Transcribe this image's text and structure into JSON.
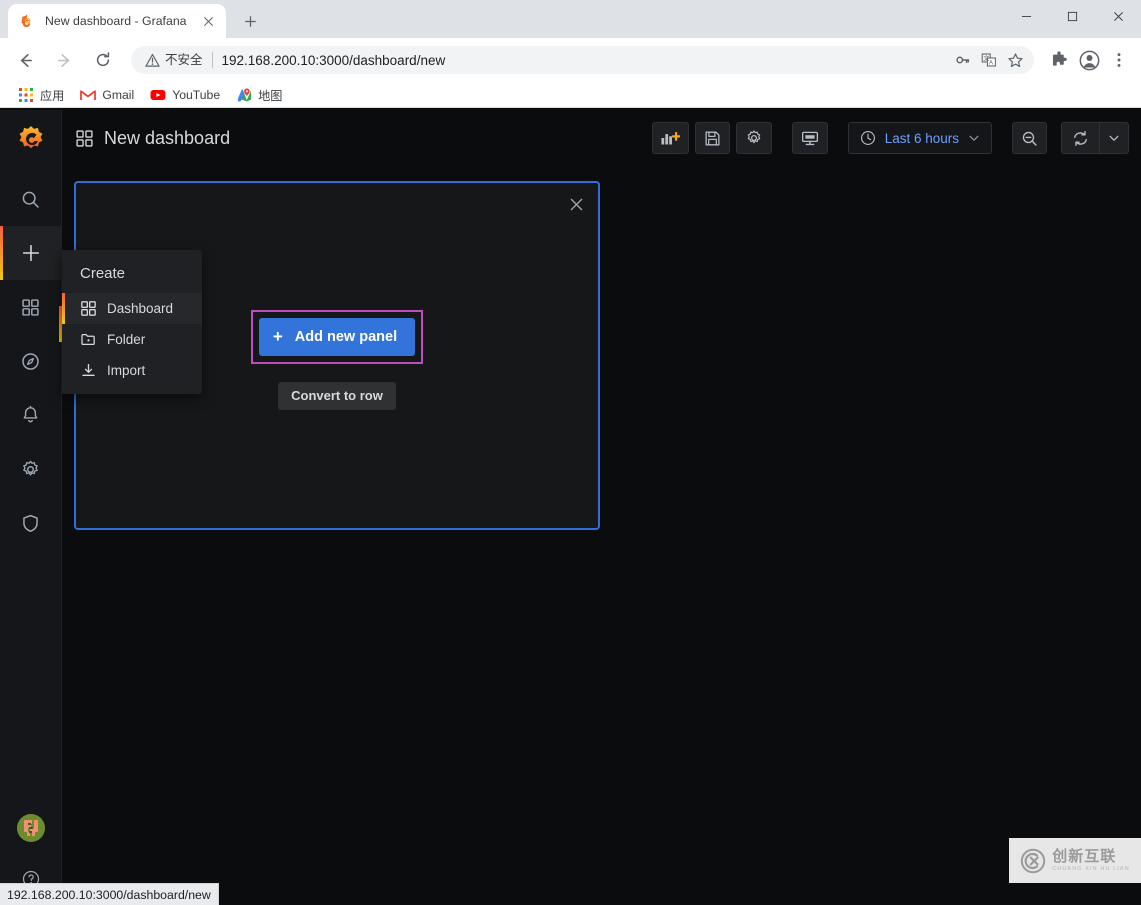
{
  "browser": {
    "tab": {
      "title": "New dashboard - Grafana",
      "favicon_icon": "grafana-logo-icon",
      "close_icon": "close-icon"
    },
    "new_tab_label": "+",
    "window_controls": {
      "minimize": "minimize-icon",
      "maximize": "maximize-icon",
      "close": "close-icon"
    },
    "nav": {
      "back_icon": "back-arrow-icon",
      "forward_icon": "forward-arrow-icon",
      "reload_icon": "reload-icon"
    },
    "omnibox": {
      "warning_icon": "warning-triangle-icon",
      "security_label": "不安全",
      "url": "192.168.200.10:3000/dashboard/new",
      "key_icon": "key-icon",
      "translate_icon": "translate-icon",
      "bookmark_icon": "star-icon"
    },
    "extensions": {
      "puzzle_icon": "puzzle-piece-icon",
      "profile_icon": "profile-avatar-icon",
      "menu_icon": "three-dots-menu-icon"
    },
    "bookmarks": [
      {
        "label": "应用",
        "icon": "apps-grid-icon"
      },
      {
        "label": "Gmail",
        "icon": "gmail-icon"
      },
      {
        "label": "YouTube",
        "icon": "youtube-icon"
      },
      {
        "label": "地图",
        "icon": "maps-icon"
      }
    ],
    "status_bar": {
      "link": "192.168.200.10:3000/dashboard/new"
    }
  },
  "grafana": {
    "sidebar": {
      "logo": "grafana-logo-icon",
      "items": [
        {
          "name": "search",
          "icon": "search-icon",
          "active": false
        },
        {
          "name": "create",
          "icon": "plus-icon",
          "active": true
        },
        {
          "name": "dashboards",
          "icon": "dashboards-grid-icon",
          "active": false
        },
        {
          "name": "explore",
          "icon": "compass-icon",
          "active": false
        },
        {
          "name": "alerting",
          "icon": "bell-icon",
          "active": false
        },
        {
          "name": "configuration",
          "icon": "gear-icon",
          "active": false
        },
        {
          "name": "server-admin",
          "icon": "shield-icon",
          "active": false
        }
      ],
      "avatar": "user-avatar",
      "help": "help-circle-icon"
    },
    "header": {
      "title": "New dashboard",
      "title_icon": "dashboards-grid-icon",
      "actions": {
        "add_panel": "add-panel-icon",
        "save": "save-disk-icon",
        "settings": "gear-icon",
        "tv_mode": "tv-monitor-icon",
        "zoom_out": "zoom-out-icon",
        "refresh": "refresh-icon",
        "refresh_caret": "chevron-down-icon"
      },
      "time_picker": {
        "clock_icon": "clock-icon",
        "label": "Last 6 hours",
        "caret": "chevron-down-icon"
      }
    },
    "panel": {
      "close_icon": "close-icon",
      "add_panel_button": {
        "plus": "+",
        "label": "Add new panel",
        "highlight_color": "#c04dc0",
        "color": "#3274d9"
      },
      "convert_button": "Convert to row"
    },
    "create_menu": {
      "title": "Create",
      "items": [
        {
          "label": "Dashboard",
          "icon": "dashboards-grid-icon",
          "active": true
        },
        {
          "label": "Folder",
          "icon": "folder-plus-icon",
          "active": false
        },
        {
          "label": "Import",
          "icon": "import-download-icon",
          "active": false
        }
      ]
    },
    "colors": {
      "page_background": "#0b0c0e",
      "panel_background": "#161719",
      "panel_border": "#2f6fd8",
      "accent_orange": "#f55f3e",
      "primary_blue": "#3274d9",
      "time_text": "#6e9fff"
    }
  },
  "watermark": {
    "cn": "创新互联",
    "en": "CHUANG XIN HU LIAN",
    "logo": "cx-circle-logo-icon"
  }
}
